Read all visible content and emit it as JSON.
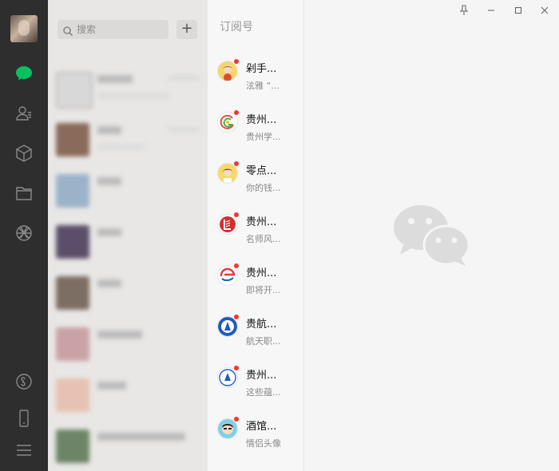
{
  "search": {
    "placeholder": "搜索"
  },
  "rail_icons": [
    "chat-icon",
    "contacts-icon",
    "favorites-icon",
    "files-icon",
    "moments-icon",
    "mini-programs-icon",
    "phone-icon",
    "menu-icon"
  ],
  "colors": {
    "accent_green": "#07c160",
    "badge_red": "#f43530",
    "rail_bg": "#2e2e2e"
  },
  "subscriptions": {
    "title": "订阅号",
    "items": [
      {
        "name": "剁手...",
        "desc": "泫雅 “..."
      },
      {
        "name": "贵州...",
        "desc": "贵州学..."
      },
      {
        "name": "零点...",
        "desc": "你的钱..."
      },
      {
        "name": "贵州...",
        "desc": "名师风..."
      },
      {
        "name": "贵州...",
        "desc": "即将开..."
      },
      {
        "name": "贵航...",
        "desc": "航天职..."
      },
      {
        "name": "贵州...",
        "desc": "这些蕴..."
      },
      {
        "name": "酒馆...",
        "desc": "情侣头像"
      }
    ]
  }
}
